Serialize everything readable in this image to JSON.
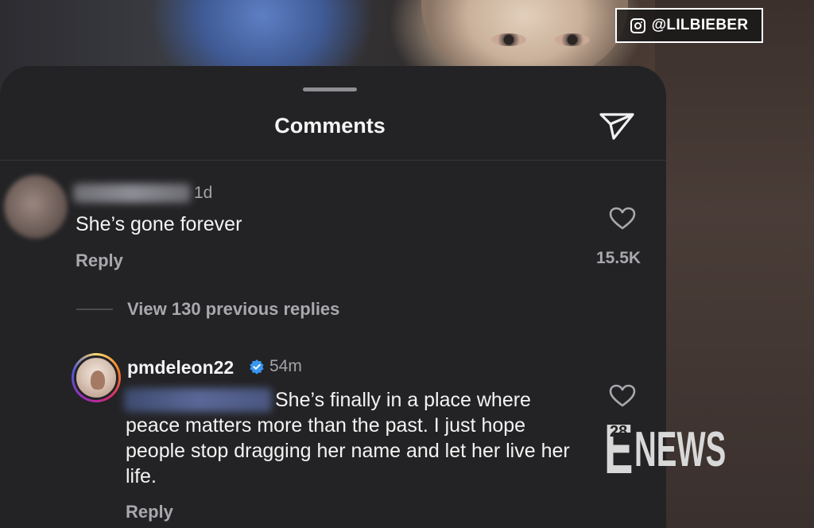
{
  "watermark": {
    "handle": "@LILBIEBER",
    "icon": "instagram-icon"
  },
  "sheet": {
    "title": "Comments",
    "send_icon": "paper-plane-icon"
  },
  "comments": [
    {
      "time": "1d",
      "text": "She’s gone forever",
      "reply_label": "Reply",
      "likes": "15.5K",
      "view_replies": "View 130 previous replies"
    },
    {
      "username": "pmdeleon22",
      "verified": true,
      "time": "54m",
      "text_first_line": "She’s finally in a place where",
      "text_rest": "peace matters more than the past. I just hope people stop dragging her name and let her live her life.",
      "reply_label": "Reply",
      "likes": "28"
    }
  ],
  "brand": {
    "logo_e": "E",
    "logo_news": "NEWS"
  },
  "colors": {
    "sheet_bg": "#232325",
    "muted_text": "#a8a8ad",
    "verified": "#3897f0"
  }
}
